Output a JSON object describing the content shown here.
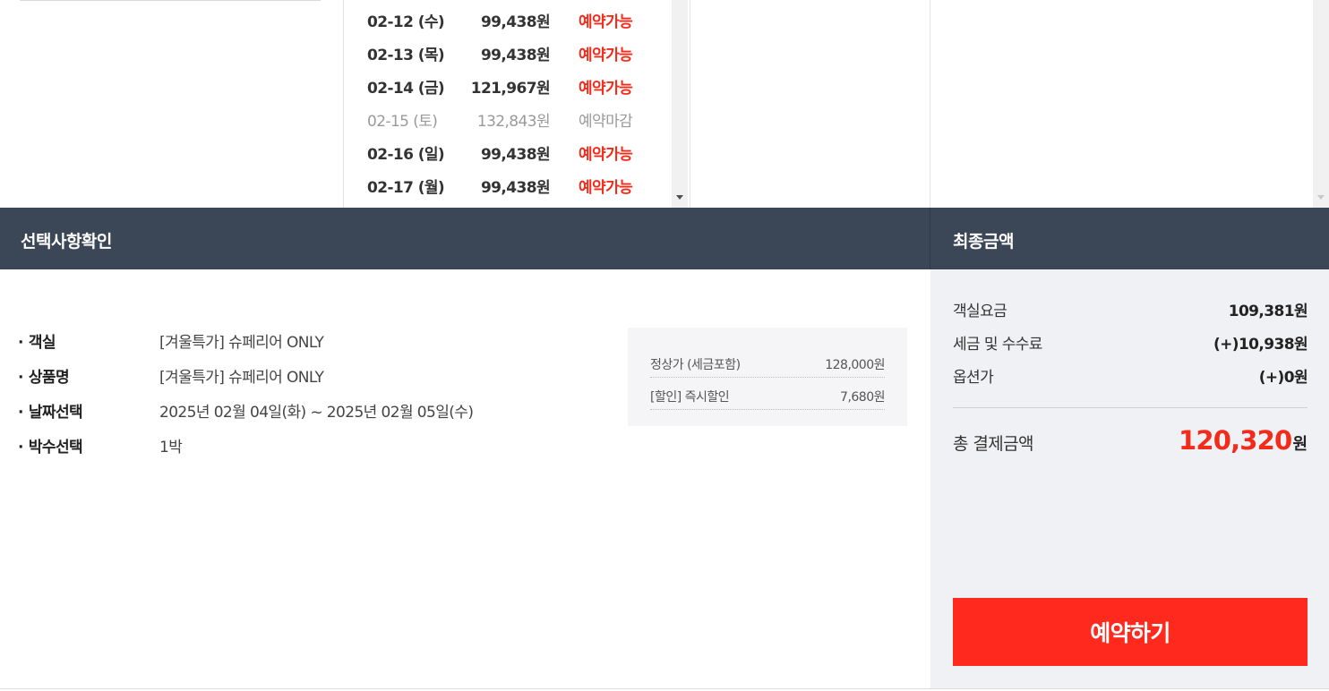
{
  "dates": [
    {
      "date": "02-12 (수)",
      "price": "99,438원",
      "status": "예약가능",
      "available": true
    },
    {
      "date": "02-13 (목)",
      "price": "99,438원",
      "status": "예약가능",
      "available": true
    },
    {
      "date": "02-14 (금)",
      "price": "121,967원",
      "status": "예약가능",
      "available": true
    },
    {
      "date": "02-15 (토)",
      "price": "132,843원",
      "status": "예약마감",
      "available": false
    },
    {
      "date": "02-16 (일)",
      "price": "99,438원",
      "status": "예약가능",
      "available": true
    },
    {
      "date": "02-17 (월)",
      "price": "99,438원",
      "status": "예약가능",
      "available": true
    }
  ],
  "selection": {
    "header": "선택사항확인",
    "items": [
      {
        "label": "객실",
        "value": "[겨울특가] 슈페리어 ONLY"
      },
      {
        "label": "상품명",
        "value": "[겨울특가] 슈페리어 ONLY"
      },
      {
        "label": "날짜선택",
        "value": "2025년 02월 04일(화) ~ 2025년 02월 05일(수)"
      },
      {
        "label": "박수선택",
        "value": "1박"
      }
    ],
    "price_breakdown": [
      {
        "label": "정상가 (세금포함)",
        "value": "128,000원"
      },
      {
        "label": "[할인] 즉시할인",
        "value": "7,680원"
      }
    ]
  },
  "final": {
    "header": "최종금액",
    "rows": [
      {
        "label": "객실요금",
        "value": "109,381원"
      },
      {
        "label": "세금 및 수수료",
        "value": "(+)10,938원"
      },
      {
        "label": "옵션가",
        "value": "(+)0원"
      }
    ],
    "total_label": "총 결제금액",
    "total_amount": "120,320",
    "total_unit": "원",
    "book_button": "예약하기"
  },
  "colors": {
    "accent": "#ff2a1d",
    "header_bg": "#3b4656",
    "final_bg": "#f0f1f5"
  },
  "icons": {
    "scroll_down": "triangle-down-icon"
  }
}
